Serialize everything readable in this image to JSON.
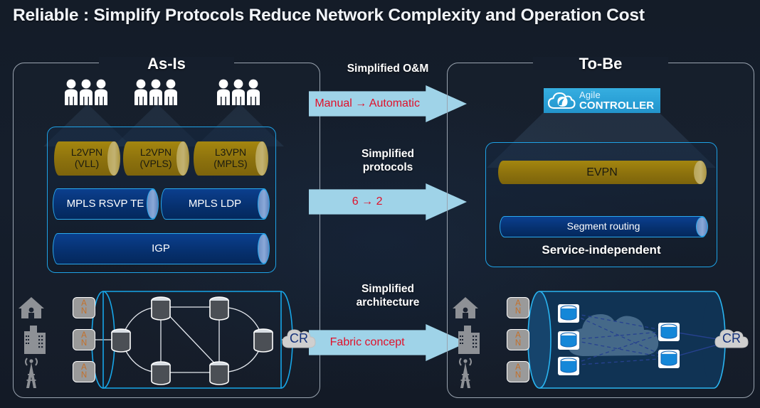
{
  "title": "Reliable : Simplify Protocols Reduce Network Complexity and Operation Cost",
  "panels": {
    "left": {
      "heading": "As-Is"
    },
    "right": {
      "heading": "To-Be"
    }
  },
  "as_is": {
    "operator_groups": 3,
    "people_per_group": 3,
    "protocols": [
      {
        "name": "L2VPN\n(VLL)",
        "line1": "L2VPN",
        "line2": "(VLL)",
        "style": "gold"
      },
      {
        "name": "L2VPN\n(VPLS)",
        "line1": "L2VPN",
        "line2": "(VPLS)",
        "style": "gold"
      },
      {
        "name": "L3VPN\n(MPLS)",
        "line1": "L3VPN",
        "line2": "(MPLS)",
        "style": "gold"
      },
      {
        "name": "MPLS RSVP TE",
        "style": "blue"
      },
      {
        "name": "MPLS LDP",
        "style": "blue"
      },
      {
        "name": "IGP",
        "style": "blue"
      }
    ],
    "topology": {
      "access_nodes": [
        "AN",
        "AN",
        "AN"
      ],
      "device_icons": [
        "home-icon",
        "building-icon",
        "cell-tower-icon"
      ],
      "core_label": "CR",
      "node_count": 6,
      "node_style": "gray-cylinder",
      "link_style": "solid-mesh"
    }
  },
  "to_be": {
    "controller": {
      "brand": "Agile",
      "product": "CONTROLLER",
      "icon": "cloud-icon",
      "background": "#2aa0d6"
    },
    "protocols": [
      {
        "name": "EVPN",
        "style": "gold"
      },
      {
        "name": "Segment routing",
        "style": "blue"
      }
    ],
    "caption": "Service-independent",
    "topology": {
      "access_nodes": [
        "AN",
        "AN",
        "AN"
      ],
      "device_icons": [
        "home-icon",
        "building-icon",
        "cell-tower-icon"
      ],
      "core_label": "CR",
      "leaf_count": 3,
      "spine_count": 2,
      "node_style": "blue-cylinder",
      "link_style": "dashed-fabric"
    }
  },
  "transitions": [
    {
      "label": "Simplified O&M",
      "arrow_text": "Manual → Automatic"
    },
    {
      "label": "Simplified\nprotocols",
      "label_line1": "Simplified",
      "label_line2": "protocols",
      "arrow_text": "6 → 2"
    },
    {
      "label": "Simplified\narchitecture",
      "label_line1": "Simplified",
      "label_line2": "architecture",
      "arrow_text": "Fabric concept"
    }
  ],
  "colors": {
    "background": "#151e2c",
    "panel_border": "#9aa4b0",
    "inner_border": "#1ea2e6",
    "arrow_fill": "#9fd3e8",
    "arrow_text": "#e0102a",
    "gold_cylinder": "#8c710d",
    "blue_cylinder": "#06306e",
    "controller_blue": "#2aa0d6",
    "core_label": "#13307a",
    "an_letter": "#c4702a"
  }
}
